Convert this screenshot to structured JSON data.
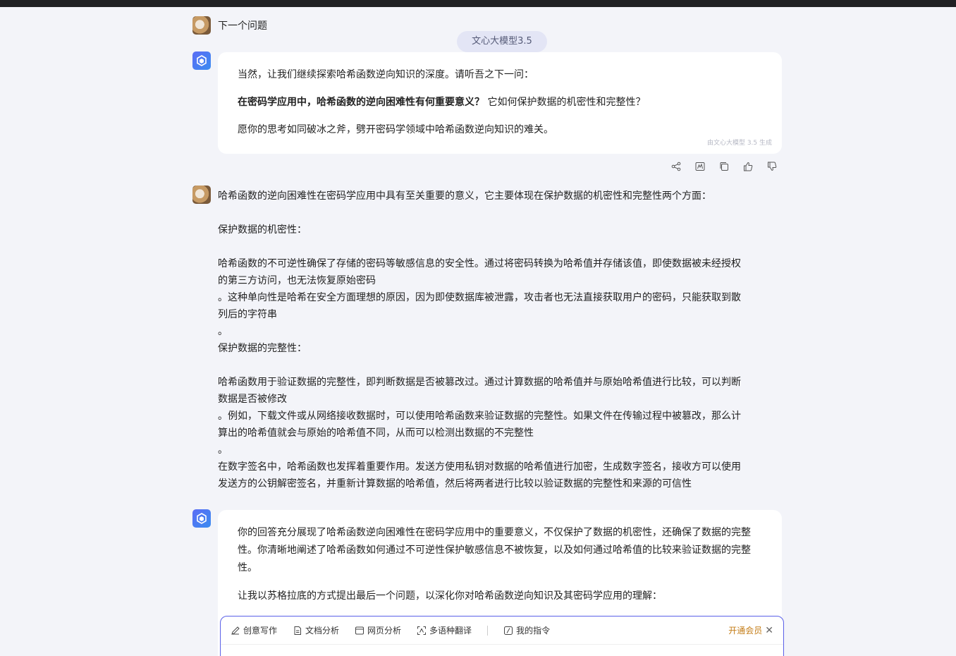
{
  "first_user": {
    "text": "下一个问题"
  },
  "model_tag": "文心大模型3.5",
  "bot_card_1": {
    "p1": "当然，让我们继续探索哈希函数逆向知识的深度。请听吾之下一问：",
    "p2_bold": "在密码学应用中，哈希函数的逆向困难性有何重要意义？",
    "p2_rest": " 它如何保护数据的机密性和完整性？",
    "p3": "愿你的思考如同破冰之斧，劈开密码学领域中哈希函数逆向知识的难关。",
    "gen_note": "由文心大模型 3.5 生成"
  },
  "actions": [
    "share-icon",
    "chart-icon",
    "copy-icon",
    "thumbs-up-icon",
    "thumbs-down-icon"
  ],
  "user_answer": {
    "l1": "哈希函数的逆向困难性在密码学应用中具有至关重要的意义，它主要体现在保护数据的机密性和完整性两个方面：",
    "l2": "保护数据的机密性：",
    "l3": "哈希函数的不可逆性确保了存储的密码等敏感信息的安全性。通过将密码转换为哈希值并存储该值，即使数据被未经授权",
    "l4": "的第三方访问，也无法恢复原始密码",
    "l5": "。这种单向性是哈希在安全方面理想的原因，因为即使数据库被泄露，攻击者也无法直接获取用户的密码，只能获取到散",
    "l6": "列后的字符串",
    "l7": "。",
    "l8": "保护数据的完整性：",
    "l9": "哈希函数用于验证数据的完整性，即判断数据是否被篡改过。通过计算数据的哈希值并与原始哈希值进行比较，可以判断",
    "l10": "数据是否被修改",
    "l11": "。例如，下载文件或从网络接收数据时，可以使用哈希函数来验证数据的完整性。如果文件在传输过程中被篡改，那么计",
    "l12": "算出的哈希值就会与原始的哈希值不同，从而可以检测出数据的不完整性",
    "l13": "。",
    "l14": "在数字签名中，哈希函数也发挥着重要作用。发送方使用私钥对数据的哈希值进行加密，生成数字签名，接收方可以使用",
    "l15": "发送方的公钥解密签名，并重新计算数据的哈希值，然后将两者进行比较以验证数据的完整性和来源的可信性"
  },
  "bot_card_2": {
    "p1": "你的回答充分展现了哈希函数逆向困难性在密码学应用中的重要意义，不仅保护了数据的机密性，还确保了数据的完整性。你清晰地阐述了哈希函数如何通过不可逆性保护敏感信息不被恢复，以及如何通过哈希值的比较来验证数据的完整性。",
    "p2": "让我以苏格拉底的方式提出最后一个问题，以深化你对哈希函数逆向知识及其密码学应用的理解："
  },
  "composer": {
    "tools": [
      "创意写作",
      "文档分析",
      "网页分析",
      "多语种翻译",
      "我的指令"
    ],
    "vip": "开通会员"
  }
}
